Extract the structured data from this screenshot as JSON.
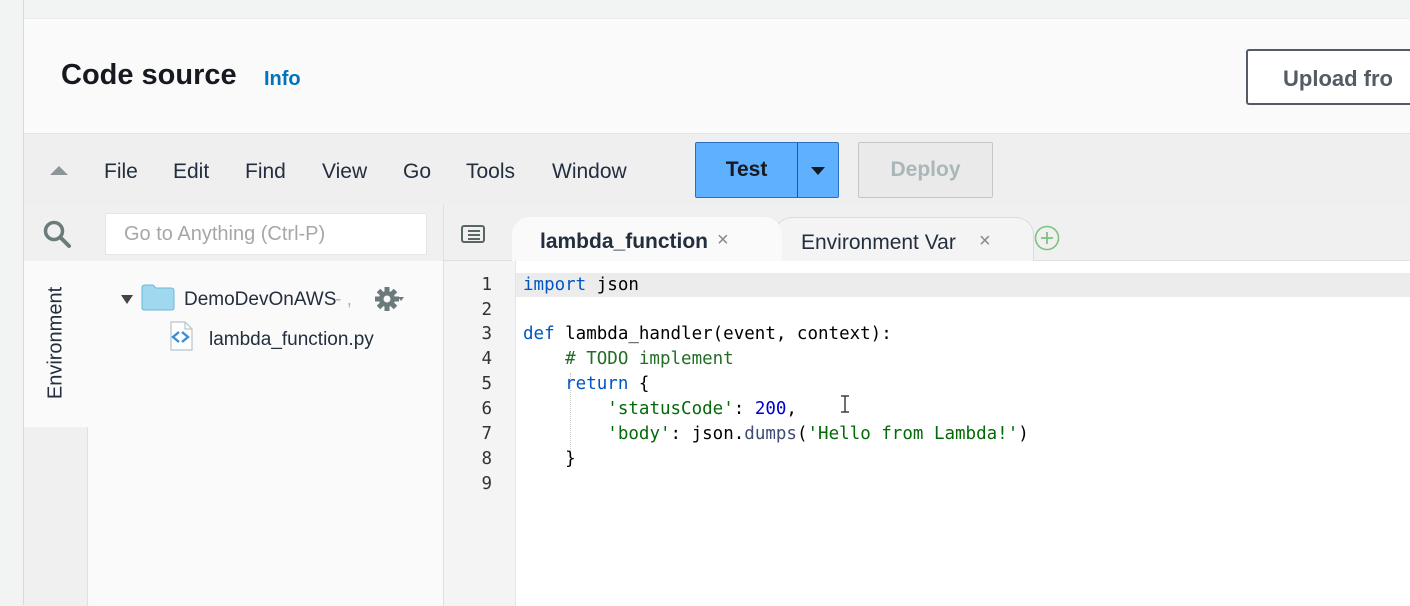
{
  "header": {
    "title": "Code source",
    "info_link": "Info",
    "upload_label": "Upload fro"
  },
  "menubar": {
    "items": [
      "File",
      "Edit",
      "Find",
      "View",
      "Go",
      "Tools",
      "Window"
    ],
    "test_label": "Test",
    "deploy_label": "Deploy"
  },
  "sidebar": {
    "search_placeholder": "Go to Anything (Ctrl-P)",
    "environment_tab": "Environment",
    "folder_name": "DemoDevOnAWS",
    "folder_suffix": "- ,",
    "file_name": "lambda_function.py"
  },
  "tabs": [
    {
      "label": "lambda_function",
      "close": "×",
      "active": true
    },
    {
      "label": "Environment Var",
      "close": "×",
      "active": false
    }
  ],
  "editor": {
    "line_numbers": [
      "1",
      "2",
      "3",
      "4",
      "5",
      "6",
      "7",
      "8",
      "9"
    ],
    "code": {
      "l1_kw": "import",
      "l1_rest": " json",
      "l3_kw": "def",
      "l3_rest": " lambda_handler(event, context):",
      "l4": "    # TODO implement",
      "l5_kw": "    return",
      "l5_rest": " {",
      "l6_key": "'statusCode'",
      "l6_sep": ": ",
      "l6_num": "200",
      "l6_end": ",",
      "l7_key": "'body'",
      "l7_sep": ": json.",
      "l7_meth": "dumps",
      "l7_open": "(",
      "l7_str": "'Hello from Lambda!'",
      "l7_close": ")",
      "l8": "    }"
    },
    "active_line": 1
  },
  "colors": {
    "accent": "#5fb0ff",
    "link": "#0073bb",
    "keyword": "#0055c4",
    "string": "#036a07",
    "comment": "#236e25"
  }
}
